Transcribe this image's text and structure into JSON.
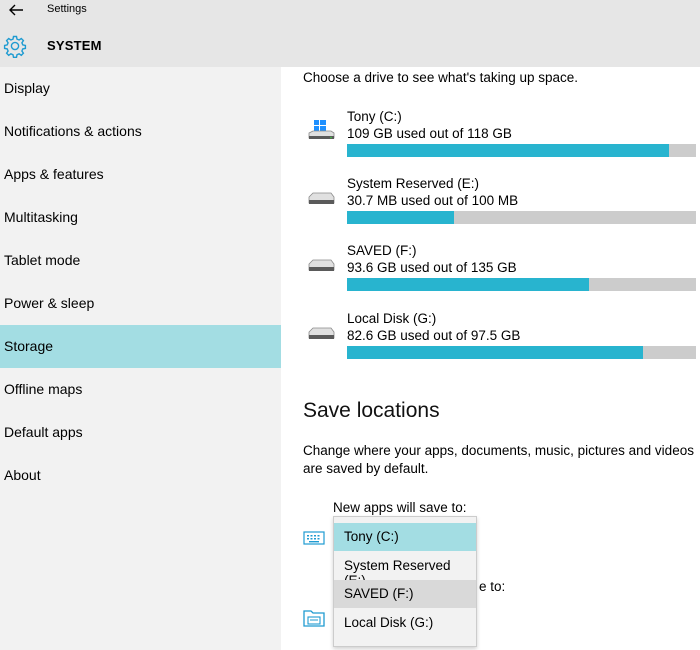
{
  "window": {
    "title": "Settings"
  },
  "header": {
    "section": "SYSTEM"
  },
  "sidebar": {
    "items": [
      {
        "label": "Display"
      },
      {
        "label": "Notifications & actions"
      },
      {
        "label": "Apps & features"
      },
      {
        "label": "Multitasking"
      },
      {
        "label": "Tablet mode"
      },
      {
        "label": "Power & sleep"
      },
      {
        "label": "Storage",
        "selected": true
      },
      {
        "label": "Offline maps"
      },
      {
        "label": "Default apps"
      },
      {
        "label": "About"
      }
    ]
  },
  "storage": {
    "hint": "Choose a drive to see what's taking up space.",
    "drives": [
      {
        "name": "Tony (C:)",
        "usage": "109 GB used out of 118 GB",
        "fraction": 0.924,
        "icon": "windows-drive-icon"
      },
      {
        "name": "System Reserved (E:)",
        "usage": "30.7 MB used out of 100 MB",
        "fraction": 0.307,
        "icon": "drive-icon"
      },
      {
        "name": "SAVED (F:)",
        "usage": "93.6 GB used out of 135 GB",
        "fraction": 0.693,
        "icon": "drive-icon"
      },
      {
        "name": "Local Disk (G:)",
        "usage": "82.6 GB used out of 97.5 GB",
        "fraction": 0.847,
        "icon": "drive-icon"
      }
    ]
  },
  "save_locations": {
    "heading": "Save locations",
    "description": "Change where your apps, documents, music, pictures and videos are saved by default.",
    "new_apps_label": "New apps will save to:",
    "partial_label": "e to:",
    "dropdown_options": [
      "Tony (C:)",
      "System Reserved (E:)",
      "SAVED (F:)",
      "Local Disk (G:)"
    ],
    "selected": "Tony (C:)",
    "hovered": "SAVED (F:)"
  },
  "colors": {
    "accent": "#28b4cf",
    "selected_bg": "#a3dde3",
    "sidebar_bg": "#f2f2f2",
    "titlebar_bg": "#e6e6e6"
  }
}
